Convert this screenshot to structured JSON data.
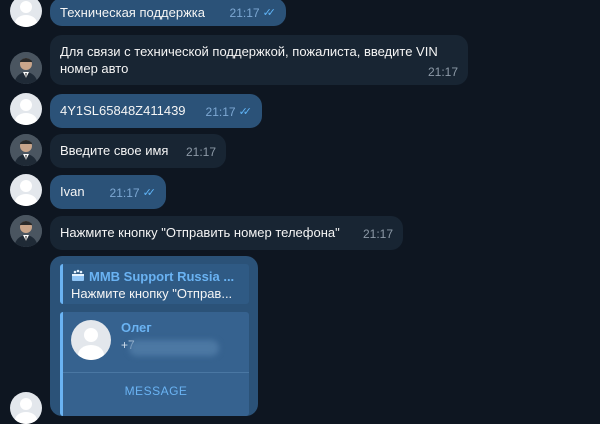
{
  "messages": [
    {
      "text": "Техническая поддержка",
      "time": "21:17",
      "ticks": "✓✓"
    },
    {
      "text_line1": "Для связи с технической поддержкой, пожалиста, введите VIN",
      "text_line2": "номер авто",
      "time": "21:17"
    },
    {
      "text": "4Y1SL65848Z411439",
      "time": "21:17",
      "ticks": "✓✓"
    },
    {
      "text": "Введите свое имя",
      "time": "21:17"
    },
    {
      "text": "Ivan",
      "time": "21:17",
      "ticks": "✓✓"
    },
    {
      "text": "Нажмите кнопку \"Отправить номер телефона\"",
      "time": "21:17"
    }
  ],
  "contact_card": {
    "quote_title": "MMB Support Russia ...",
    "quote_text": "Нажмите кнопку \"Отправ...",
    "contact_name": "Олег",
    "contact_phone": "+7",
    "button_label": "MESSAGE"
  },
  "icons": {
    "user_avatar": "person-silhouette-icon",
    "bot_avatar": "man-in-suit-avatar",
    "quote_icon": "cake-icon",
    "read_receipt": "double-check-icon"
  },
  "colors": {
    "background": "#0e1621",
    "incoming_bubble": "#182533",
    "outgoing_bubble": "#2b5278",
    "accent": "#6ab3f3",
    "ticks": "#5fb3f5"
  }
}
